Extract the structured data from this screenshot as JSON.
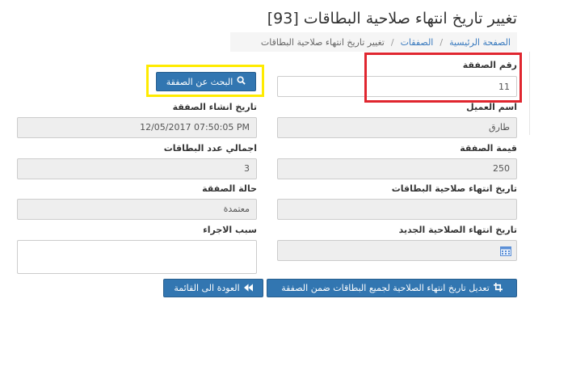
{
  "page": {
    "title": "تغيير تاريخ انتهاء صلاحية البطاقات [93]"
  },
  "breadcrumb": {
    "home": "الصفحة الرئيسية",
    "deals": "الصفقات",
    "current": "تغيير تاريخ انتهاء صلاحية البطاقات"
  },
  "form": {
    "deal_number": {
      "label": "رقم الصفقة",
      "value": "11"
    },
    "search_button": {
      "label": "البحث عن الصفقة",
      "icon": "search-icon"
    },
    "customer_name": {
      "label": "اسم العميل",
      "value": "طارق"
    },
    "deal_created_date": {
      "label": "تاريخ انشاء الصفقة",
      "value": "12/05/2017 07:50:05 PM"
    },
    "deal_value": {
      "label": "قيمة الصفقة",
      "value": "250"
    },
    "total_cards": {
      "label": "اجمالي عدد البطاقات",
      "value": "3"
    },
    "cards_expiry_date": {
      "label": "تاريخ انتهاء صلاحية البطاقات",
      "value": ""
    },
    "deal_status": {
      "label": "حالة الصفقة",
      "value": "معتمدة"
    },
    "new_expiry_date": {
      "label": "تاريخ انتهاء الصلاحية الجديد",
      "value": "",
      "icon": "calendar-icon"
    },
    "procedure_reason": {
      "label": "سبب الاجراء",
      "value": ""
    }
  },
  "actions": {
    "update_expiry": {
      "label": "تعديل تاريخ انتهاء الصلاحية لجميع البطاقات ضمن الصفقة",
      "icon": "crop-icon"
    },
    "back_to_list": {
      "label": "العودة الى القائمة",
      "icon": "double-chevron-icon"
    }
  },
  "colors": {
    "primary": "#3276b1",
    "link": "#3a7bbf",
    "readonly_bg": "#eeeeee",
    "highlight_yellow": "#ffeb00",
    "highlight_red": "#e0262f"
  }
}
